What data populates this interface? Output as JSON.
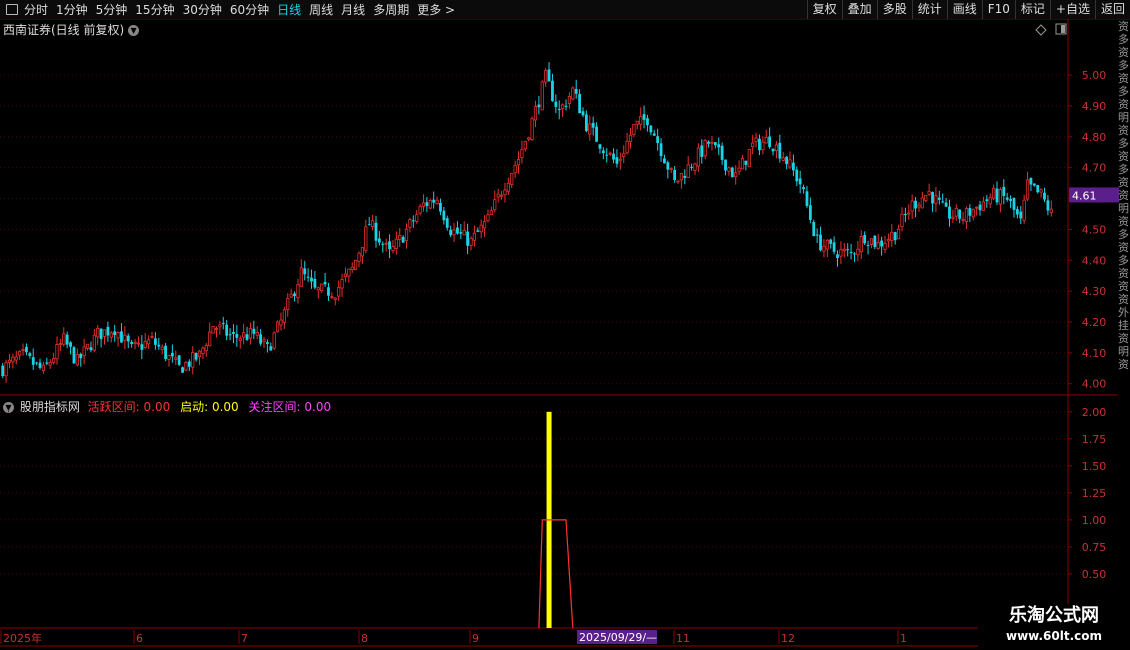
{
  "toolbar": {
    "periods": [
      "分时",
      "1分钟",
      "5分钟",
      "15分钟",
      "30分钟",
      "60分钟",
      "日线",
      "周线",
      "月线",
      "多周期"
    ],
    "active_period": "日线",
    "more_label": "更多 >",
    "tools": [
      "复权",
      "叠加",
      "多股",
      "统计",
      "画线",
      "F10",
      "标记",
      "+自选",
      "返回"
    ]
  },
  "main_chart": {
    "title": "西南证券(日线 前复权)",
    "price_ticks": [
      "5.00",
      "4.90",
      "4.80",
      "4.70",
      "4.60",
      "4.50",
      "4.40",
      "4.30",
      "4.20",
      "4.10",
      "4.00"
    ],
    "current_price": "4.61",
    "colors": {
      "up": "#e83030",
      "down": "#19d3e6",
      "axis": "#8b0000",
      "price_tag": "#5a1f8a"
    }
  },
  "indicator": {
    "name": "股朋指标网",
    "v1_label": "活跃区间:",
    "v1_value": "0.00",
    "v2_label": "启动:",
    "v2_value": "0.00",
    "v3_label": "关注区间:",
    "v3_value": "0.00",
    "ticks": [
      "2.00",
      "1.75",
      "1.50",
      "1.25",
      "1.00",
      "0.75",
      "0.50"
    ]
  },
  "time_axis": {
    "labels": [
      "2025年",
      "6",
      "7",
      "8",
      "9",
      "11",
      "12",
      "1"
    ],
    "cursor_label": "2025/09/29/—"
  },
  "watermark": {
    "title": "乐淘公式网",
    "url": "www.60lt.com"
  },
  "side_strip_text": "资多资多资多资明资多资多资资明资多资多资资资外挂资明资",
  "chart_data": {
    "type": "candlestick",
    "ylim": [
      3.97,
      5.12
    ],
    "price_ticks": [
      5.0,
      4.9,
      4.8,
      4.7,
      4.6,
      4.5,
      4.4,
      4.3,
      4.2,
      4.1,
      4.0
    ],
    "current_price": 4.61,
    "close_path": [
      [
        0,
        4.05
      ],
      [
        6,
        4.09
      ],
      [
        12,
        4.04
      ],
      [
        18,
        4.14
      ],
      [
        22,
        4.07
      ],
      [
        28,
        4.16
      ],
      [
        33,
        4.18
      ],
      [
        38,
        4.11
      ],
      [
        44,
        4.14
      ],
      [
        52,
        4.05
      ],
      [
        58,
        4.09
      ],
      [
        62,
        4.19
      ],
      [
        68,
        4.15
      ],
      [
        74,
        4.16
      ],
      [
        78,
        4.11
      ],
      [
        82,
        4.2
      ],
      [
        88,
        4.36
      ],
      [
        92,
        4.3
      ],
      [
        98,
        4.3
      ],
      [
        103,
        4.37
      ],
      [
        108,
        4.52
      ],
      [
        114,
        4.42
      ],
      [
        118,
        4.48
      ],
      [
        124,
        4.58
      ],
      [
        128,
        4.6
      ],
      [
        132,
        4.5
      ],
      [
        138,
        4.46
      ],
      [
        143,
        4.53
      ],
      [
        148,
        4.65
      ],
      [
        152,
        4.73
      ],
      [
        156,
        4.85
      ],
      [
        160,
        4.99
      ],
      [
        164,
        4.88
      ],
      [
        168,
        4.95
      ],
      [
        172,
        4.84
      ],
      [
        176,
        4.78
      ],
      [
        181,
        4.71
      ],
      [
        186,
        4.83
      ],
      [
        190,
        4.86
      ],
      [
        194,
        4.76
      ],
      [
        198,
        4.65
      ],
      [
        202,
        4.7
      ],
      [
        208,
        4.78
      ],
      [
        212,
        4.73
      ],
      [
        216,
        4.67
      ],
      [
        221,
        4.77
      ],
      [
        226,
        4.79
      ],
      [
        230,
        4.74
      ],
      [
        235,
        4.65
      ],
      [
        240,
        4.46
      ],
      [
        245,
        4.43
      ],
      [
        250,
        4.42
      ],
      [
        254,
        4.48
      ],
      [
        258,
        4.45
      ],
      [
        263,
        4.49
      ],
      [
        268,
        4.58
      ],
      [
        273,
        4.62
      ],
      [
        278,
        4.55
      ],
      [
        283,
        4.54
      ],
      [
        288,
        4.58
      ],
      [
        292,
        4.61
      ],
      [
        296,
        4.6
      ],
      [
        300,
        4.52
      ],
      [
        302,
        4.64
      ],
      [
        306,
        4.61
      ],
      [
        309,
        4.55
      ]
    ],
    "indicator": {
      "ylim": [
        0,
        2.1
      ],
      "qidong_bar": {
        "index": 161,
        "value": 2.0
      },
      "line": [
        [
          158,
          0
        ],
        [
          159,
          1.0
        ],
        [
          166,
          1.0
        ],
        [
          168,
          0
        ]
      ]
    }
  }
}
